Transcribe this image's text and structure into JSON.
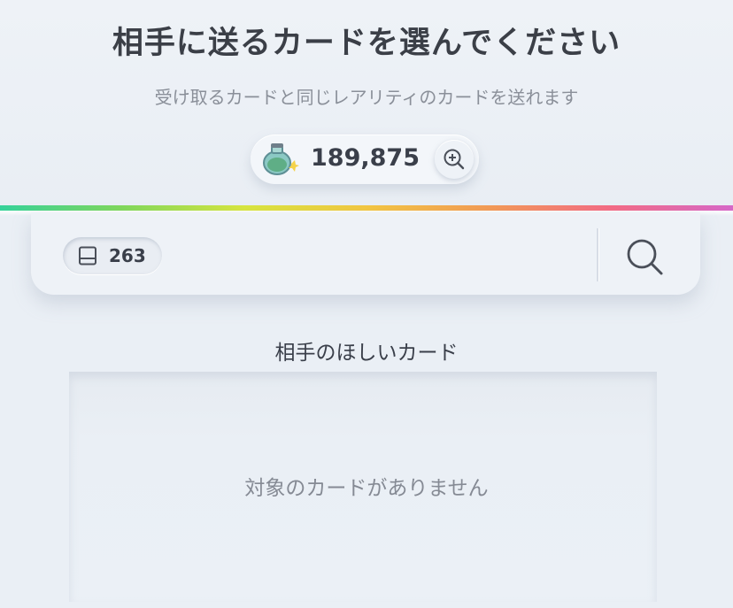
{
  "header": {
    "title": "相手に送るカードを選んでください",
    "subtitle": "受け取るカードと同じレアリティのカードを送れます"
  },
  "currency": {
    "icon": "potion-icon",
    "amount": "189,875",
    "zoom_icon": "zoom-in-icon"
  },
  "search_bar": {
    "card_count": "263",
    "card_icon": "card-icon",
    "search_icon": "search-icon"
  },
  "section": {
    "label": "相手のほしいカード",
    "empty_message": "対象のカードがありません"
  },
  "colors": {
    "background": "#eaeff5",
    "title_text": "#3b3f47",
    "muted_text": "#858a94",
    "rainbow": [
      "#35d29a",
      "#7fd85a",
      "#d8e63d",
      "#f3c640",
      "#f39a54",
      "#f46a84",
      "#d668c8"
    ]
  }
}
